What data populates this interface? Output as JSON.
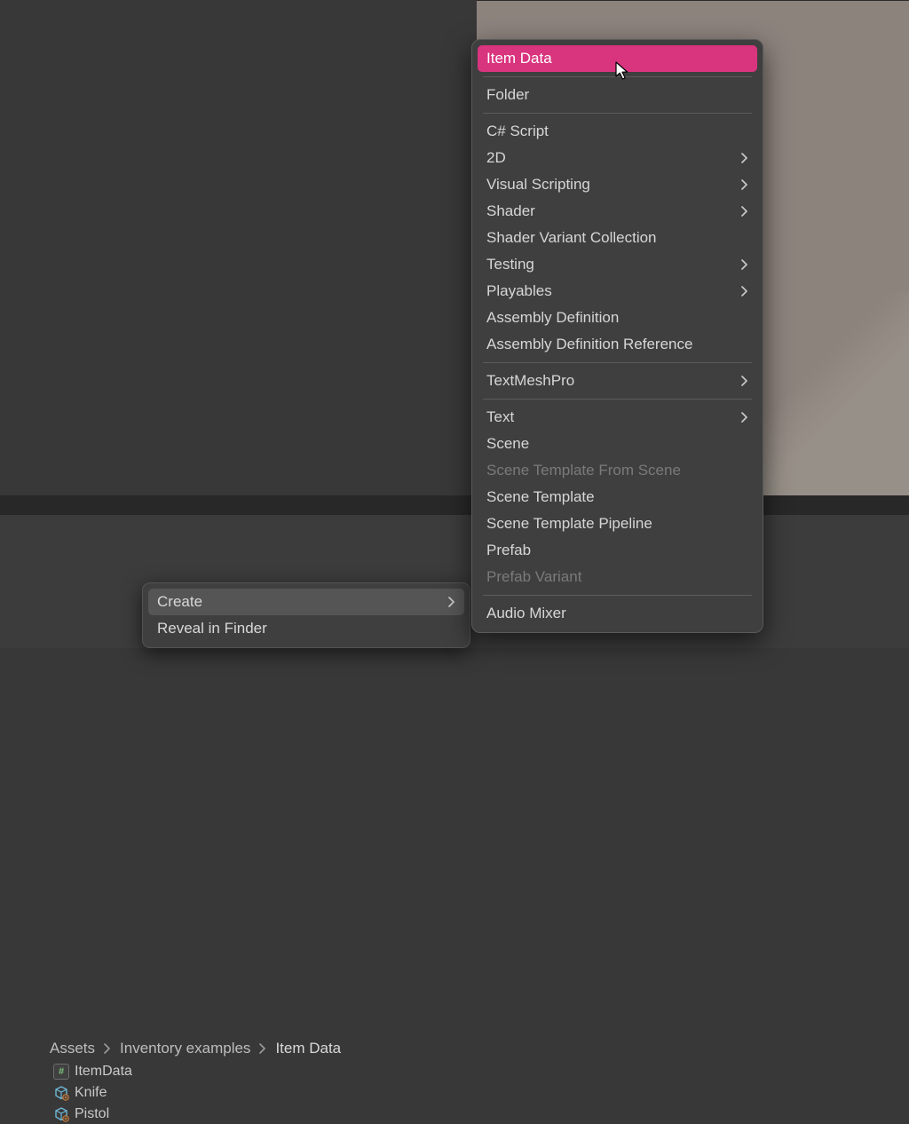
{
  "breadcrumb": {
    "items": [
      "Assets",
      "Inventory examples",
      "Item Data"
    ]
  },
  "assets": [
    {
      "type": "script",
      "label": "ItemData"
    },
    {
      "type": "prefab",
      "label": "Knife"
    },
    {
      "type": "prefab",
      "label": "Pistol"
    }
  ],
  "context_menu_1": {
    "items": [
      {
        "label": "Create",
        "submenu": true,
        "highlight": true
      },
      {
        "label": "Reveal in Finder",
        "submenu": false,
        "highlight": false
      }
    ]
  },
  "create_submenu": {
    "groups": [
      [
        {
          "label": "Item Data",
          "submenu": false,
          "selected": true
        }
      ],
      [
        {
          "label": "Folder",
          "submenu": false
        }
      ],
      [
        {
          "label": "C# Script",
          "submenu": false
        },
        {
          "label": "2D",
          "submenu": true
        },
        {
          "label": "Visual Scripting",
          "submenu": true
        },
        {
          "label": "Shader",
          "submenu": true
        },
        {
          "label": "Shader Variant Collection",
          "submenu": false
        },
        {
          "label": "Testing",
          "submenu": true
        },
        {
          "label": "Playables",
          "submenu": true
        },
        {
          "label": "Assembly Definition",
          "submenu": false
        },
        {
          "label": "Assembly Definition Reference",
          "submenu": false
        }
      ],
      [
        {
          "label": "TextMeshPro",
          "submenu": true
        }
      ],
      [
        {
          "label": "Text",
          "submenu": true
        },
        {
          "label": "Scene",
          "submenu": false
        },
        {
          "label": "Scene Template From Scene",
          "submenu": false,
          "disabled": true
        },
        {
          "label": "Scene Template",
          "submenu": false
        },
        {
          "label": "Scene Template Pipeline",
          "submenu": false
        },
        {
          "label": "Prefab",
          "submenu": false
        },
        {
          "label": "Prefab Variant",
          "submenu": false,
          "disabled": true
        }
      ],
      [
        {
          "label": "Audio Mixer",
          "submenu": false
        }
      ]
    ]
  },
  "icons": {
    "script_hash": "#"
  }
}
